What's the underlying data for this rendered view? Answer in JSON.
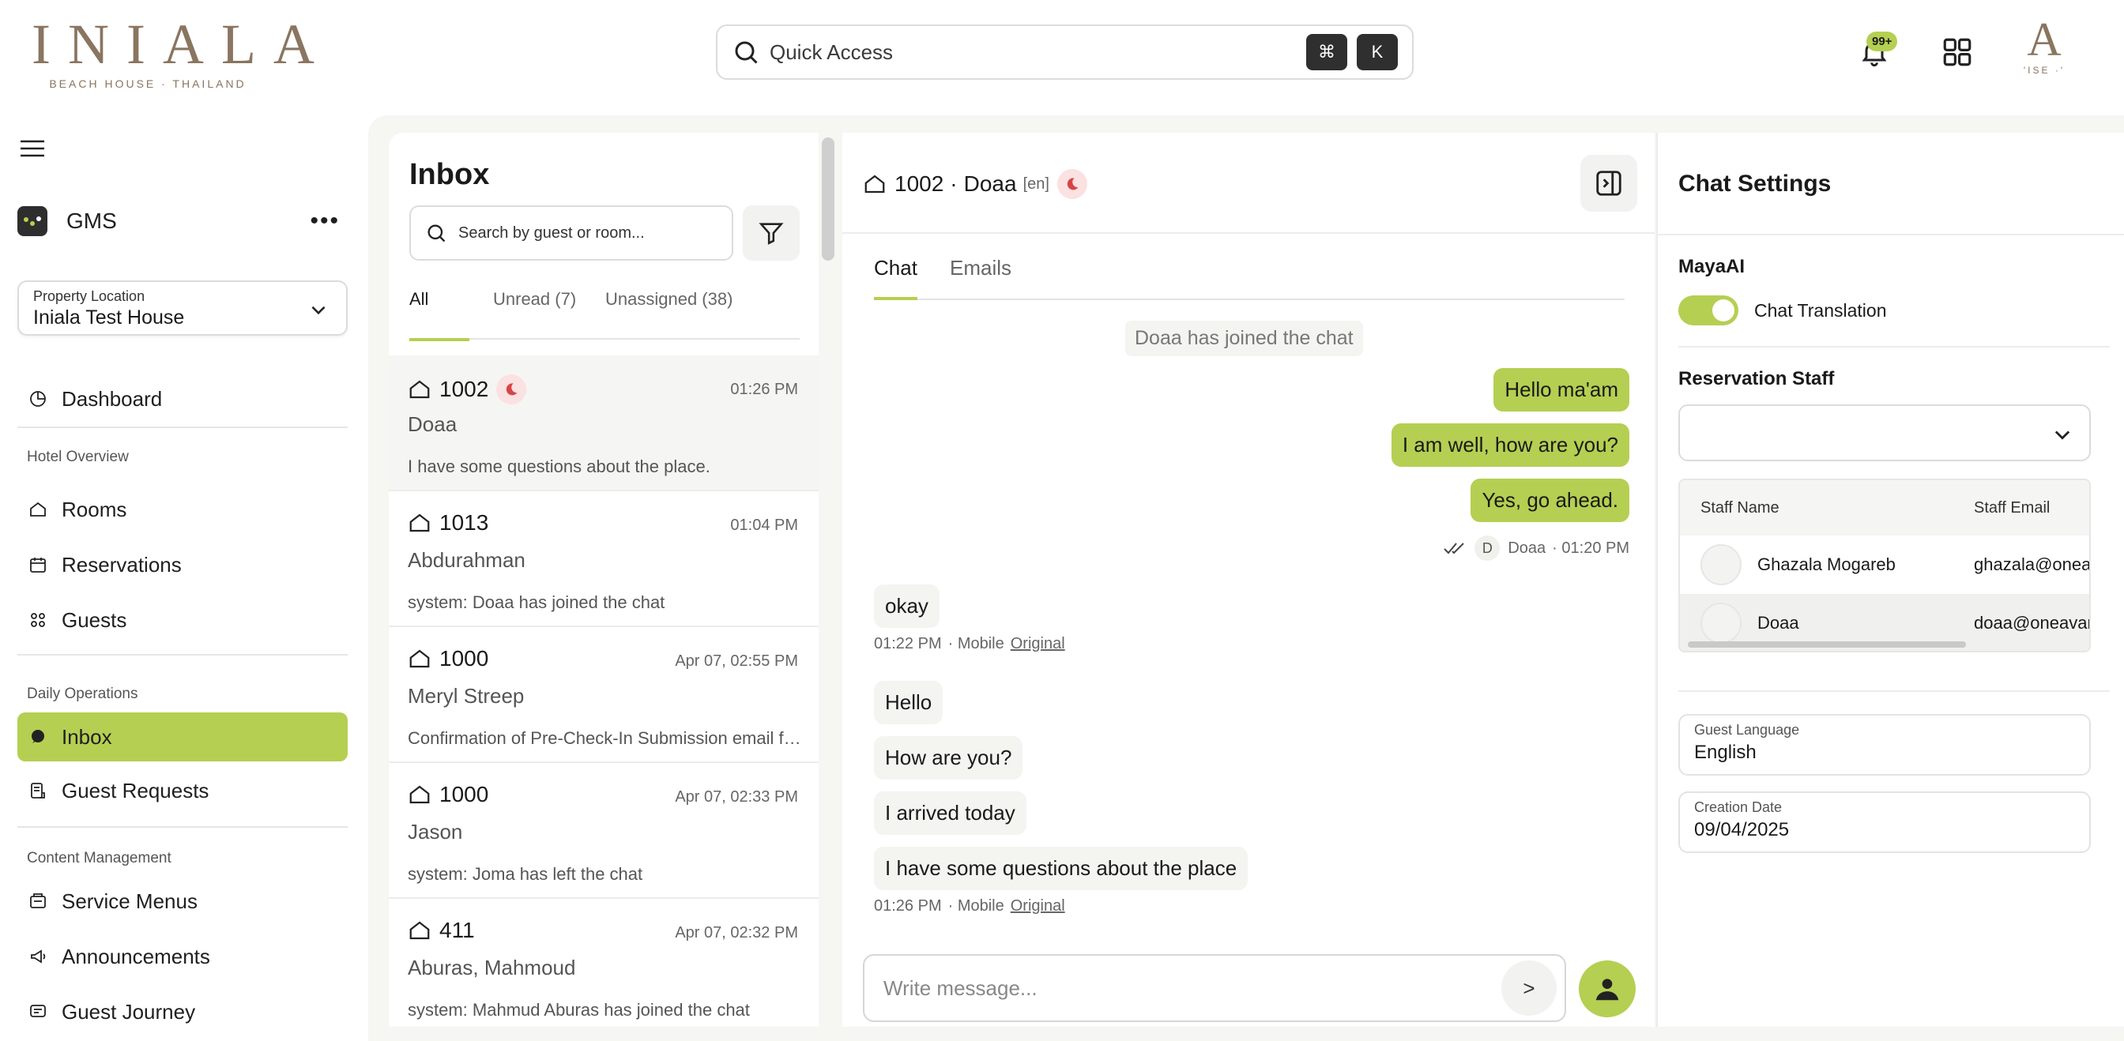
{
  "brand": {
    "name": "INIALA",
    "tagline": "BEACH HOUSE · THAILAND",
    "avatar_letter": "A",
    "avatar_sub": "'ISE ·'"
  },
  "topbar": {
    "quick_access": "Quick Access",
    "kbd_cmd": "⌘",
    "kbd_k": "K",
    "notif_badge": "99+"
  },
  "sidebar": {
    "app_name": "GMS",
    "more": "•••",
    "property_label": "Property Location",
    "property_value": "Iniala Test House",
    "dashboard": "Dashboard",
    "sections": {
      "hotel": "Hotel Overview",
      "daily": "Daily Operations",
      "content": "Content Management"
    },
    "items": {
      "rooms": "Rooms",
      "reservations": "Reservations",
      "guests": "Guests",
      "inbox": "Inbox",
      "guest_requests": "Guest Requests",
      "service_menus": "Service Menus",
      "announcements": "Announcements",
      "guest_journey": "Guest Journey"
    }
  },
  "inbox": {
    "title": "Inbox",
    "search_placeholder": "Search by guest or room...",
    "tabs": [
      "All",
      "Unread (7)",
      "Unassigned (38)"
    ],
    "conversations": [
      {
        "room": "1002",
        "time": "01:26 PM",
        "guest": "Doaa",
        "preview": "I have some questions about the place."
      },
      {
        "room": "1013",
        "time": "01:04 PM",
        "guest": "Abdurahman",
        "preview": "system: Doaa has joined the chat"
      },
      {
        "room": "1000",
        "time": "Apr 07, 02:55 PM",
        "guest": "Meryl Streep",
        "preview": "Confirmation of Pre-Check-In Submission email for Meryl Streep"
      },
      {
        "room": "1000",
        "time": "Apr 07, 02:33 PM",
        "guest": "Jason",
        "preview": "system: Joma has left the chat"
      },
      {
        "room": "411",
        "time": "Apr 07, 02:32 PM",
        "guest": "Aburas, Mahmoud",
        "preview": "system: Mahmud Aburas has joined the chat"
      }
    ]
  },
  "chat": {
    "room": "1002",
    "sep": "·",
    "guest": "Doaa",
    "lang": "[en]",
    "tabs": [
      "Chat",
      "Emails"
    ],
    "system_msg": "Doaa has joined the chat",
    "out_msgs": [
      "Hello ma'am",
      "I am well, how are you?",
      "Yes, go ahead."
    ],
    "out_meta": {
      "initial": "D",
      "name": "Doaa",
      "time": "· 01:20 PM"
    },
    "in_msg_1": "okay",
    "in_meta_1": {
      "time": "01:22 PM",
      "device": "· Mobile",
      "link": "Original"
    },
    "in_msgs_2": [
      "Hello",
      "How are you?",
      "I arrived today",
      "I have some questions about the place"
    ],
    "in_meta_2": {
      "time": "01:26 PM",
      "device": "· Mobile",
      "link": "Original"
    },
    "composer_placeholder": "Write message...",
    "send": ">"
  },
  "settings": {
    "title": "Chat Settings",
    "maya": "MayaAI",
    "translation": "Chat Translation",
    "translation_on": true,
    "res_staff": "Reservation Staff",
    "table_headers": [
      "Staff Name",
      "Staff Email"
    ],
    "staff": [
      {
        "name": "Ghazala Mogareb",
        "email": "ghazala@oneavan"
      },
      {
        "name": "Doaa",
        "email": "doaa@oneavan"
      }
    ],
    "guest_lang_label": "Guest Language",
    "guest_lang": "English",
    "creation_label": "Creation Date",
    "creation": "09/04/2025"
  },
  "colors": {
    "accent": "#b5cf52",
    "brand": "#8a7560",
    "moon": "#d64545"
  }
}
